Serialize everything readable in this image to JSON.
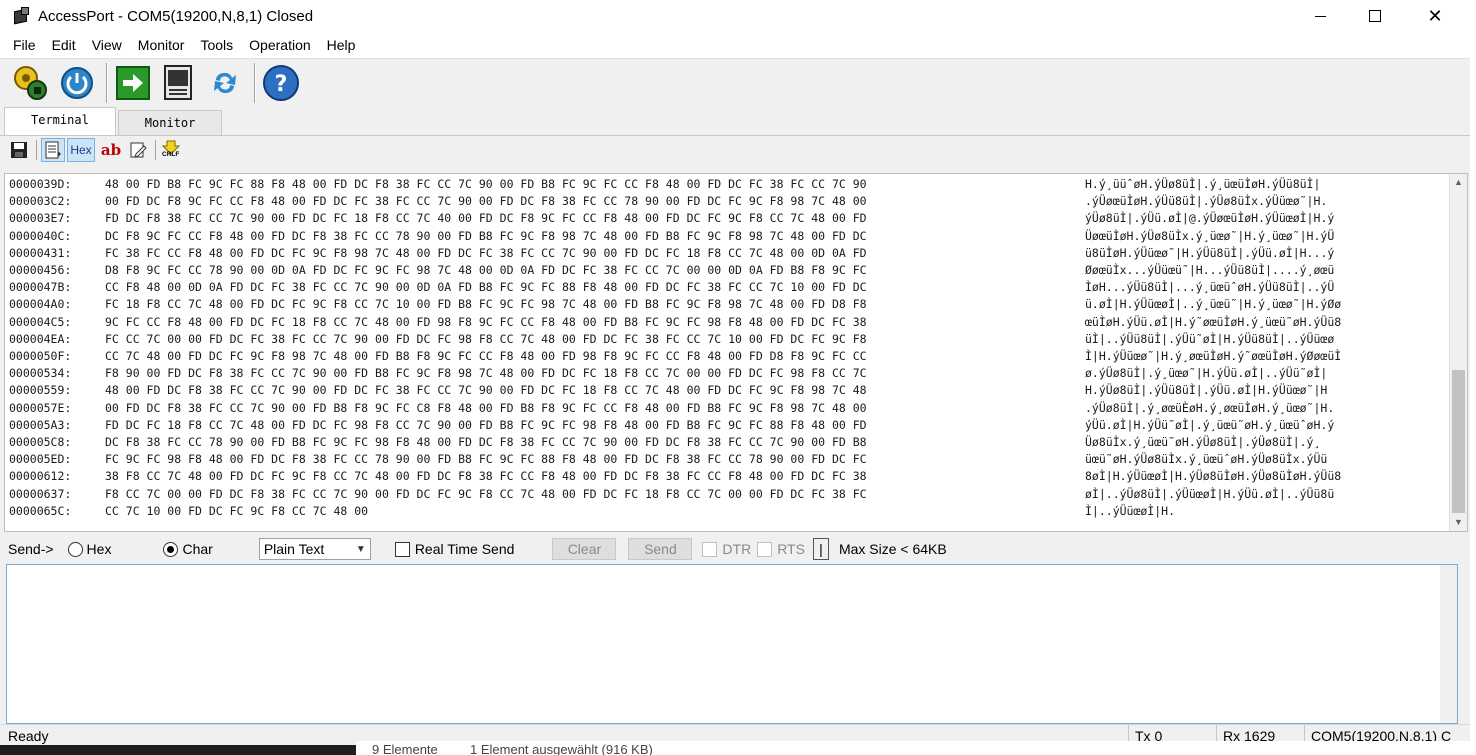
{
  "window": {
    "title": "AccessPort - COM5(19200,N,8,1) Closed",
    "controls": [
      "minimize",
      "maximize",
      "close"
    ]
  },
  "menu": [
    "File",
    "Edit",
    "View",
    "Monitor",
    "Tools",
    "Operation",
    "Help"
  ],
  "toolbar": {
    "icons": [
      "settings-gear-icon",
      "power-icon",
      "run-arrow-icon",
      "log-document-icon",
      "refresh-icon",
      "help-icon"
    ]
  },
  "tabs": [
    "Terminal",
    "Monitor"
  ],
  "subtoolbar": {
    "hex_label": "Hex",
    "ab_label": "ab",
    "crlf_label": "CRLF"
  },
  "hex_view": {
    "rows": [
      {
        "addr": "0000039D:",
        "hex": "48 00 FD B8 FC 9C FC 88 F8 48 00 FD DC F8 38 FC CC 7C 90 00 FD B8 FC 9C FC CC F8 48 00 FD DC FC 38 FC CC 7C 90",
        "ascii": "H.ý¸ü­üˆøH.ýÜø8üÌ|.ý¸üœüÌøH.ýÜü8üÌ|"
      },
      {
        "addr": "000003C2:",
        "hex": "00 FD DC F8 9C FC CC F8 48 00 FD DC FC 38 FC CC 7C 90 00 FD DC F8 38 FC CC 78 90 00 FD DC FC 9C F8 98 7C 48 00",
        "ascii": ".ýÜøœüÌøH.ýÜü8üÌ|.ýÜø8üÌx.ýÜüœø˜|H."
      },
      {
        "addr": "000003E7:",
        "hex": "FD DC F8 38 FC CC 7C 90 00 FD DC FC 18 F8 CC 7C 40 00 FD DC F8 9C FC CC F8 48 00 FD DC FC 9C F8 CC 7C 48 00 FD",
        "ascii": "ýÜø8üÌ|.ýÜü.øÌ|@.ýÜøœüÌøH.ýÜüœøÌ|H.ý"
      },
      {
        "addr": "0000040C:",
        "hex": "DC F8 9C FC CC F8 48 00 FD DC F8 38 FC CC 78 90 00 FD B8 FC 9C F8 98 7C 48 00 FD B8 FC 9C F8 98 7C 48 00 FD DC",
        "ascii": "ÜøœüÌøH.ýÜø8üÌx.ý¸üœø˜|H.ý¸üœø˜|H.ýÜ"
      },
      {
        "addr": "00000431:",
        "hex": "FC 38 FC CC F8 48 00 FD DC FC 9C F8 98 7C 48 00 FD DC FC 38 FC CC 7C 90 00 FD DC FC 18 F8 CC 7C 48 00 0D 0A FD",
        "ascii": "ü8üÌøH.ýÜüœø˜|H.ýÜü8üÌ|.ýÜü.øÌ|H...ý"
      },
      {
        "addr": "00000456:",
        "hex": "D8 F8 9C FC CC 78 90 00 0D 0A FD DC FC 9C FC 98 7C 48 00 0D 0A FD DC FC 38 FC CC 7C 00 00 0D 0A FD B8 F8 9C FC",
        "ascii": "ØøœüÌx...ýÜüœü˜|H...ýÜü8üÌ|....ý¸øœü"
      },
      {
        "addr": "0000047B:",
        "hex": "CC F8 48 00 0D 0A FD DC FC 38 FC CC 7C 90 00 0D 0A FD B8 FC 9C FC 88 F8 48 00 FD DC FC 38 FC CC 7C 10 00 FD DC",
        "ascii": "ÌøH...ýÜü8üÌ|...ý¸üœüˆøH.ýÜü8üÌ|..ýÜ"
      },
      {
        "addr": "000004A0:",
        "hex": "FC 18 F8 CC 7C 48 00 FD DC FC 9C F8 CC 7C 10 00 FD B8 FC 9C FC 98 7C 48 00 FD B8 FC 9C F8 98 7C 48 00 FD D8 F8",
        "ascii": "ü.øÌ|H.ýÜüœøÌ|..ý¸üœü˜|H.ý¸üœø˜|H.ýØø"
      },
      {
        "addr": "000004C5:",
        "hex": "9C FC CC F8 48 00 FD DC FC 18 F8 CC 7C 48 00 FD 98 F8 9C FC CC F8 48 00 FD B8 FC 9C FC 98 F8 48 00 FD DC FC 38",
        "ascii": "œüÌøH.ýÜü.øÌ|H.ý˜øœüÌøH.ý¸üœü˜øH.ýÜü8"
      },
      {
        "addr": "000004EA:",
        "hex": "FC CC 7C 00 00 FD DC FC 38 FC CC 7C 90 00 FD DC FC 98 F8 CC 7C 48 00 FD DC FC 38 FC CC 7C 10 00 FD DC FC 9C F8",
        "ascii": "üÌ|..ýÜü8üÌ|.ýÜü˜øÌ|H.ýÜü8üÌ|..ýÜüœø"
      },
      {
        "addr": "0000050F:",
        "hex": "CC 7C 48 00 FD DC FC 9C F8 98 7C 48 00 FD B8 F8 9C FC CC F8 48 00 FD 98 F8 9C FC CC F8 48 00 FD D8 F8 9C FC CC",
        "ascii": "Ì|H.ýÜüœø˜|H.ý¸øœüÌøH.ý˜øœüÌøH.ýØøœüÌ"
      },
      {
        "addr": "00000534:",
        "hex": "F8 90 00 FD DC F8 38 FC CC 7C 90 00 FD B8 FC 9C F8 98 7C 48 00 FD DC FC 18 F8 CC 7C 00 00 FD DC FC 98 F8 CC 7C",
        "ascii": "ø.ýÜø8üÌ|.ý¸üœø˜|H.ýÜü.øÌ|..ýÜü˜øÌ|"
      },
      {
        "addr": "00000559:",
        "hex": "48 00 FD DC F8 38 FC CC 7C 90 00 FD DC FC 38 FC CC 7C 90 00 FD DC FC 18 F8 CC 7C 48 00 FD DC FC 9C F8 98 7C 48",
        "ascii": "H.ýÜø8üÌ|.ýÜü8üÌ|.ýÜü.øÌ|H.ýÜüœø˜|H"
      },
      {
        "addr": "0000057E:",
        "hex": "00 FD DC F8 38 FC CC 7C 90 00 FD B8 F8 9C FC C8 F8 48 00 FD B8 F8 9C FC CC F8 48 00 FD B8 FC 9C F8 98 7C 48 00",
        "ascii": ".ýÜø8üÌ|.ý¸øœüÈøH.ý¸øœüÌøH.ý¸üœø˜|H."
      },
      {
        "addr": "000005A3:",
        "hex": "FD DC FC 18 F8 CC 7C 48 00 FD DC FC 98 F8 CC 7C 90 00 FD B8 FC 9C FC 98 F8 48 00 FD B8 FC 9C FC 88 F8 48 00 FD",
        "ascii": "ýÜü.øÌ|H.ýÜü˜øÌ|.ý¸üœü˜øH.ý¸üœüˆøH.ý"
      },
      {
        "addr": "000005C8:",
        "hex": "DC F8 38 FC CC 78 90 00 FD B8 FC 9C FC 98 F8 48 00 FD DC F8 38 FC CC 7C 90 00 FD DC F8 38 FC CC 7C 90 00 FD B8",
        "ascii": "Üø8üÌx.ý¸üœü˜øH.ýÜø8üÌ|.ýÜø8üÌ|.ý¸"
      },
      {
        "addr": "000005ED:",
        "hex": "FC 9C FC 98 F8 48 00 FD DC F8 38 FC CC 78 90 00 FD B8 FC 9C FC 88 F8 48 00 FD DC F8 38 FC CC 78 90 00 FD DC FC",
        "ascii": "üœü˜øH.ýÜø8üÌx.ý¸üœüˆøH.ýÜø8üÌx.ýÜü"
      },
      {
        "addr": "00000612:",
        "hex": "38 F8 CC 7C 48 00 FD DC FC 9C F8 CC 7C 48 00 FD DC F8 38 FC CC F8 48 00 FD DC F8 38 FC CC F8 48 00 FD DC FC 38",
        "ascii": "8øÌ|H.ýÜüœøÌ|H.ýÜø8üÌøH.ýÜø8üÌøH.ýÜü8"
      },
      {
        "addr": "00000637:",
        "hex": "F8 CC 7C 00 00 FD DC F8 38 FC CC 7C 90 00 FD DC FC 9C F8 CC 7C 48 00 FD DC FC 18 F8 CC 7C 00 00 FD DC FC 38 FC",
        "ascii": "øÌ|..ýÜø8üÌ|.ýÜüœøÌ|H.ýÜü.øÌ|..ýÜü8ü"
      },
      {
        "addr": "0000065C:",
        "hex": "CC 7C 10 00 FD DC FC 9C F8 CC 7C 48 00",
        "ascii": "Ì|..ýÜüœøÌ|H."
      }
    ]
  },
  "sendbar": {
    "label": "Send->",
    "hex_label": "Hex",
    "char_label": "Char",
    "format_value": "Plain Text",
    "realtime_label": "Real Time Send",
    "clear_label": "Clear",
    "send_label": "Send",
    "dtr_label": "DTR",
    "rts_label": "RTS",
    "pipe_label": "|",
    "maxsize_label": "Max Size < 64KB"
  },
  "statusbar": {
    "ready": "Ready",
    "tx": "Tx 0",
    "rx": "Rx 1629",
    "port": "COM5(19200,N,8,1) C"
  },
  "background": {
    "explorer_items": "9 Elemente",
    "explorer_selected": "1 Element ausgewählt (916 KB)"
  }
}
